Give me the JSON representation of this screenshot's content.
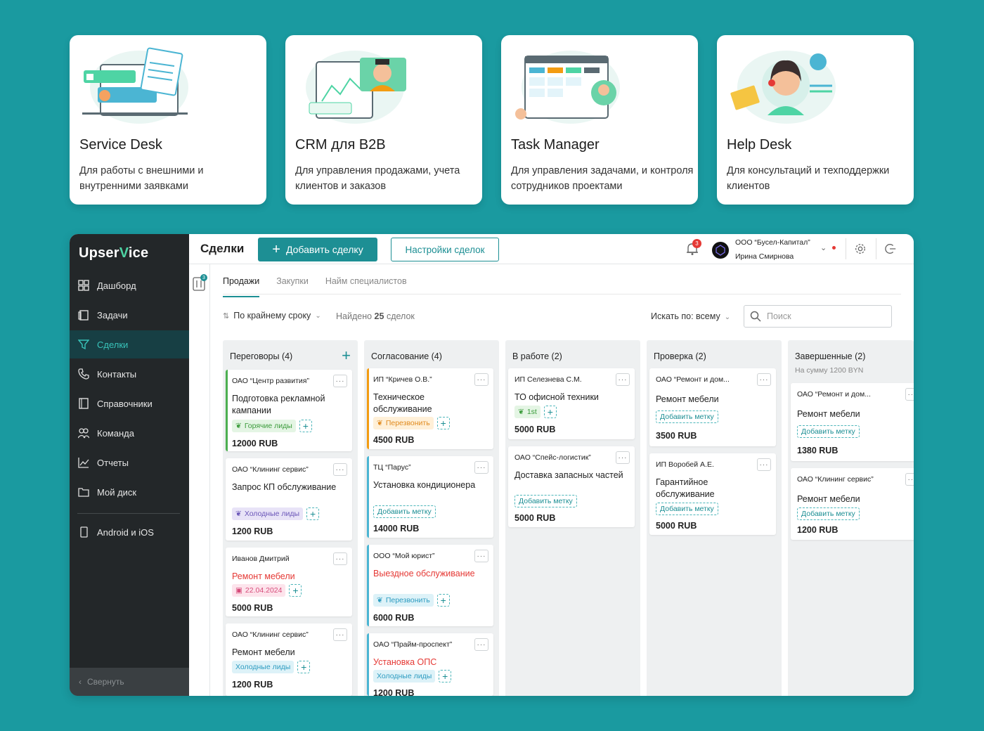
{
  "colors": {
    "accent": "#1d8f94",
    "sidebar_bg": "#232729",
    "page_bg": "#1a9aa0",
    "danger": "#e53935"
  },
  "products": [
    {
      "title": "Service Desk",
      "desc": "Для работы с внешними и внутренними заявками"
    },
    {
      "title": "CRM для B2B",
      "desc": "Для управления продажами, учета клиентов и заказов"
    },
    {
      "title": "Task Manager",
      "desc": "Для управления задачами, и контроля сотрудников проектами"
    },
    {
      "title": "Help Desk",
      "desc": "Для консультаций и техподдержки клиентов"
    }
  ],
  "sidebar": {
    "logo_a": "Upser",
    "logo_b": "V",
    "logo_c": "ice",
    "items": [
      {
        "label": "Дашборд",
        "icon": "dashboard-icon"
      },
      {
        "label": "Задачи",
        "icon": "tasks-icon"
      },
      {
        "label": "Сделки",
        "icon": "funnel-icon",
        "active": true
      },
      {
        "label": "Контакты",
        "icon": "phone-icon"
      },
      {
        "label": "Справочники",
        "icon": "book-icon"
      },
      {
        "label": "Команда",
        "icon": "team-icon"
      },
      {
        "label": "Отчеты",
        "icon": "chart-icon"
      },
      {
        "label": "Мой диск",
        "icon": "folder-icon"
      },
      {
        "label": "Android и iOS",
        "icon": "mobile-icon"
      }
    ],
    "collapse": "Свернуть"
  },
  "topbar": {
    "title": "Сделки",
    "add_label": "Добавить сделку",
    "settings_label": "Настройки сделок",
    "notif_count": "3",
    "org": "ООО “Бусел-Капитал”",
    "user": "Ирина Смирнова"
  },
  "subrail": {
    "badge": "3"
  },
  "tabs": [
    "Продажи",
    "Закупки",
    "Найм специалистов"
  ],
  "toolbar": {
    "sort_label": "По крайнему сроку",
    "found_prefix": "Найдено",
    "found_count": "25",
    "found_suffix": "сделок",
    "search_by": "Искать по: всему",
    "search_placeholder": "Поиск"
  },
  "columns": [
    {
      "name": "Переговоры (4)",
      "deals": [
        {
          "client": "ОАО “Центр развития”",
          "title": "Подготовка рекламной кампании",
          "tag": "Горячие лиды",
          "tag_color": "green",
          "amount": "12000 RUB"
        },
        {
          "client": "ОАО “Клининг сервис”",
          "title": "Запрос КП обслуживание",
          "tag": "Холодные лиды",
          "tag_color": "purple",
          "amount": "1200 RUB"
        },
        {
          "client": "Иванов Дмитрий",
          "title": "Ремонт мебели",
          "tag": "22.04.2024",
          "tag_color": "pink",
          "amount": "5000 RUB"
        },
        {
          "client": "ОАО “Клининг сервис”",
          "title": "Ремонт мебели",
          "tag": "Холодные лиды",
          "tag_color": "cyan",
          "amount": "1200 RUB"
        }
      ]
    },
    {
      "name": "Согласование (4)",
      "deals": [
        {
          "client": "ИП “Кричев О.В.”",
          "title": "Техническое обслуживание",
          "tag": "Перезвонить",
          "tag_color": "orange",
          "amount": "4500 RUB"
        },
        {
          "client": "ТЦ “Парус”",
          "title": "Установка кондиционера",
          "tag": "Добавить метку",
          "tag_color": "empty",
          "amount": "14000 RUB"
        },
        {
          "client": "ООО “Мой юрист”",
          "title": "Выездное обслуживание",
          "tag": "Перезвонить",
          "tag_color": "cyan",
          "amount": "6000 RUB"
        },
        {
          "client": "ОАО “Прайм-проспект”",
          "title": "Установка ОПС",
          "tag": "Холодные лиды",
          "tag_color": "cyan",
          "amount": "1200 RUB"
        }
      ]
    },
    {
      "name": "В работе (2)",
      "deals": [
        {
          "client": "ИП Селезнева С.М.",
          "title": "ТО офисной техники",
          "tag": "1st",
          "tag_color": "green",
          "amount": "5000 RUB"
        },
        {
          "client": "ОАО “Спейс-логистик”",
          "title": "Доставка запасных частей",
          "tag": "Добавить метку",
          "tag_color": "empty",
          "amount": "5000 RUB"
        }
      ]
    },
    {
      "name": "Проверка (2)",
      "deals": [
        {
          "client": "ОАО “Ремонт и дом...",
          "title": "Ремонт мебели",
          "tag": "Добавить метку",
          "tag_color": "empty",
          "amount": "3500 RUB"
        },
        {
          "client": "ИП Воробей А.Е.",
          "title": "Гарантийное обслуживание",
          "tag": "Добавить метку",
          "tag_color": "empty",
          "amount": "5000 RUB"
        }
      ]
    },
    {
      "name": "Завершенные (2)",
      "sum": "На сумму 1200 BYN",
      "deals": [
        {
          "client": "ОАО “Ремонт и дом...",
          "title": "Ремонт мебели",
          "tag": "Добавить метку",
          "tag_color": "empty",
          "amount": "1380 RUB"
        },
        {
          "client": "ОАО “Клининг сервис”",
          "title": "Ремонт мебели",
          "tag": "Добавить метку",
          "tag_color": "empty",
          "amount": "1200 RUB"
        }
      ]
    }
  ]
}
